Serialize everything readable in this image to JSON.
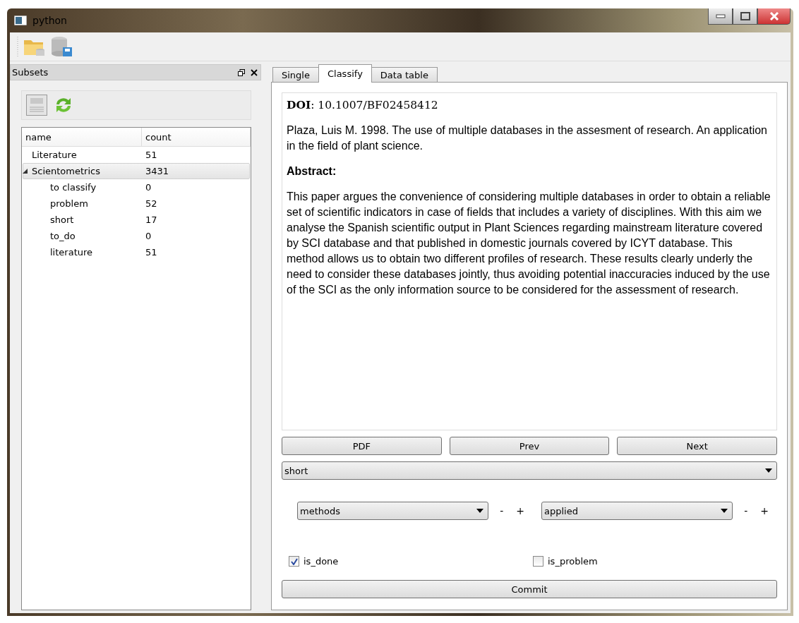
{
  "window": {
    "title": "python"
  },
  "dock": {
    "title": "Subsets",
    "tree": {
      "columns": [
        "name",
        "count"
      ],
      "rows": [
        {
          "name": "Literature",
          "count": "51",
          "selected": false
        },
        {
          "name": "Scientometrics",
          "count": "3431",
          "selected": true,
          "expanded": true,
          "children": [
            {
              "name": "to classify",
              "count": "0",
              "selected": false
            },
            {
              "name": "problem",
              "count": "52",
              "selected": false
            },
            {
              "name": "short",
              "count": "17",
              "selected": false
            },
            {
              "name": "to_do",
              "count": "0",
              "selected": false
            },
            {
              "name": "literature",
              "count": "51",
              "selected": false
            }
          ]
        }
      ]
    }
  },
  "tabs": [
    {
      "label": "Single",
      "selected": false
    },
    {
      "label": "Classify",
      "selected": true
    },
    {
      "label": "Data table",
      "selected": false
    }
  ],
  "document": {
    "doi_label": "DOI",
    "doi": ": 10.1007/BF02458412",
    "citation": "Plaza, Luis M. 1998. The use of multiple databases in the assesment of research. An application in the field of plant science.",
    "abstract_heading": "Abstract:",
    "abstract": "This paper argues the convenience of considering multiple databases in order to obtain a reliable set of scientific indicators in case of fields that includes a variety of disciplines. With this aim we analyse the Spanish scientific output in Plant Sciences regarding mainstream literature covered by SCI database and that published in domestic journals covered by ICYT database. This method allows us to obtain two different profiles of research. These results clearly underly the need to consider these databases jointly, thus avoiding potential inaccuracies induced by the use of the SCI as the only information source to be considered for the assessment of research."
  },
  "nav_buttons": [
    "PDF",
    "Prev",
    "Next"
  ],
  "category": {
    "value": "short"
  },
  "tag_selectors": [
    {
      "value": "methods",
      "minus": "-",
      "plus": "+"
    },
    {
      "value": "applied",
      "minus": "-",
      "plus": "+"
    }
  ],
  "checkboxes": [
    {
      "label": "is_done",
      "checked": true
    },
    {
      "label": "is_problem",
      "checked": false
    }
  ],
  "commit": "Commit"
}
